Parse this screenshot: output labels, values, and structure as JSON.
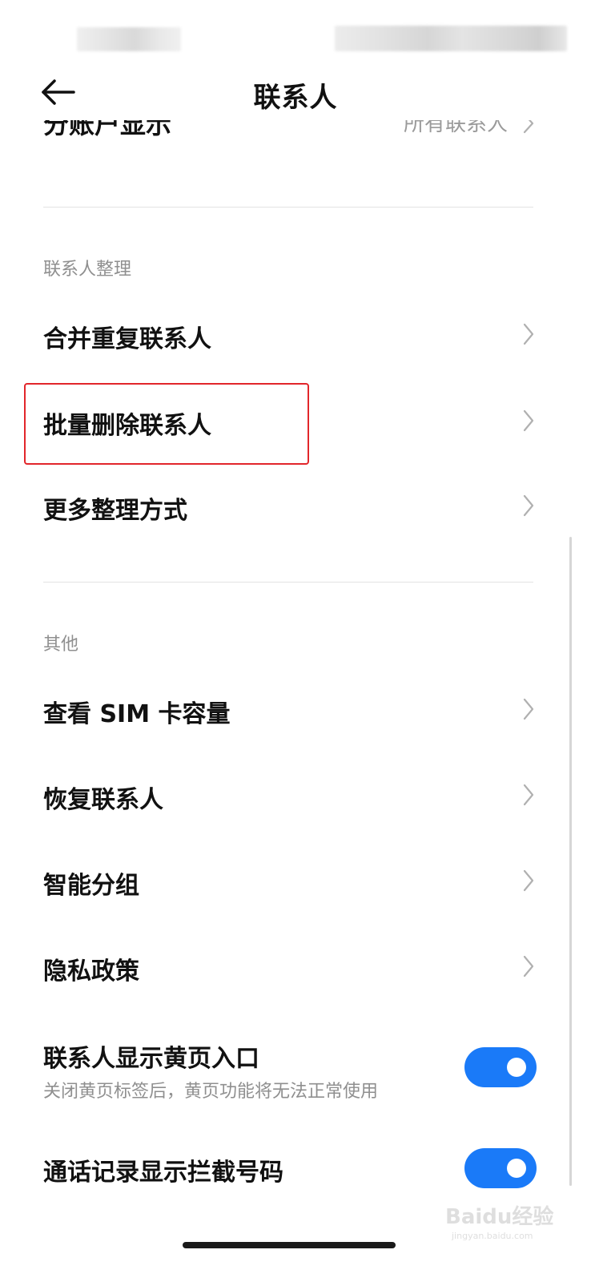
{
  "header": {
    "title": "联系人"
  },
  "partial_row": {
    "label": "分账户显示",
    "value": "所有联系人"
  },
  "sections": [
    {
      "title": "联系人整理",
      "items": [
        {
          "label": "合并重复联系人"
        },
        {
          "label": "批量删除联系人",
          "highlighted": true
        },
        {
          "label": "更多整理方式"
        }
      ]
    },
    {
      "title": "其他",
      "items": [
        {
          "label": "查看 SIM 卡容量"
        },
        {
          "label": "恢复联系人"
        },
        {
          "label": "智能分组"
        },
        {
          "label": "隐私政策"
        }
      ]
    }
  ],
  "toggles": [
    {
      "label": "联系人显示黄页入口",
      "description": "关闭黄页标签后，黄页功能将无法正常使用",
      "on": true
    },
    {
      "label": "通话记录显示拦截号码",
      "on": true
    }
  ],
  "colors": {
    "accent": "#1a7af8",
    "highlight": "#e2262b",
    "section_text": "#8f8f8f"
  },
  "watermark": {
    "brand": "Baidu经验",
    "url": "jingyan.baidu.com"
  }
}
